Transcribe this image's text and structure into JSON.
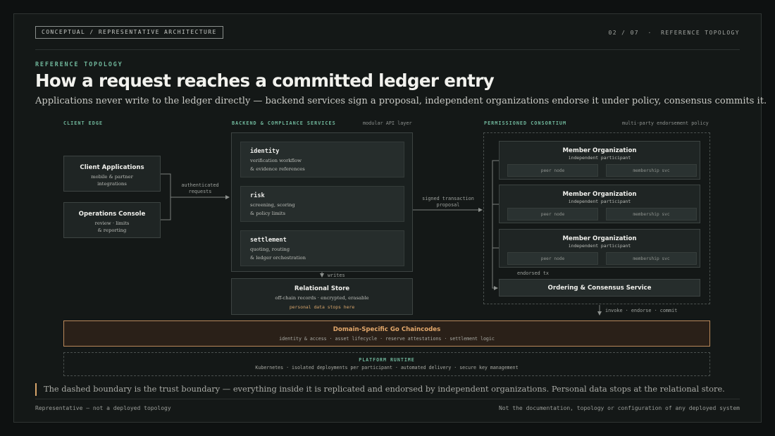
{
  "header": {
    "tag": "CONCEPTUAL / REPRESENTATIVE ARCHITECTURE",
    "page_indicator": "02 / 07  ·  REFERENCE TOPOLOGY"
  },
  "hero": {
    "eyebrow": "REFERENCE TOPOLOGY",
    "title": "How a request reaches a committed ledger entry",
    "subtitle": "Applications never write to the ledger directly — backend services sign a proposal, independent organizations endorse it under policy, consensus commits it."
  },
  "client_edge": {
    "heading": "CLIENT EDGE",
    "boxes": [
      {
        "title": "Client Applications",
        "sub1": "mobile & partner",
        "sub2": "integrations"
      },
      {
        "title": "Operations Console",
        "sub1": "review · limits",
        "sub2": "& reporting"
      }
    ],
    "edge_label_1": "authenticated",
    "edge_label_2": "requests"
  },
  "backend": {
    "heading": "BACKEND & COMPLIANCE SERVICES",
    "note": "modular API layer",
    "services": [
      {
        "title": "identity",
        "line1": "verification workflow",
        "line2": "& evidence references"
      },
      {
        "title": "risk",
        "line1": "screening, scoring",
        "line2": "& policy limits"
      },
      {
        "title": "settlement",
        "line1": "quoting, routing",
        "line2": "& ledger orchestration"
      }
    ],
    "writes_label": "writes",
    "edge_label_1": "signed transaction",
    "edge_label_2": "proposal"
  },
  "relational_store": {
    "title": "Relational Store",
    "sub": "off-chain records · encrypted, erasable",
    "note": "personal data stops here"
  },
  "consortium": {
    "heading": "PERMISSIONED CONSORTIUM",
    "note": "multi-party endorsement policy",
    "orgs": [
      {
        "title": "Member Organization",
        "sub": "independent participant",
        "pill1": "peer node",
        "pill2": "membership svc"
      },
      {
        "title": "Member Organization",
        "sub": "independent participant",
        "pill1": "peer node",
        "pill2": "membership svc"
      },
      {
        "title": "Member Organization",
        "sub": "independent participant",
        "pill1": "peer node",
        "pill2": "membership svc"
      }
    ],
    "endorsed_label": "endorsed tx",
    "ordering": "Ordering & Consensus Service",
    "invoke_label": "invoke · endorse · commit"
  },
  "chaincodes": {
    "title": "Domain-Specific Go Chaincodes",
    "sub": "identity & access · asset lifecycle · reserve attestations · settlement logic"
  },
  "runtime": {
    "heading": "PLATFORM RUNTIME",
    "sub": "Kubernetes · isolated deployments per participant · automated delivery · secure key management"
  },
  "callout": "The dashed boundary is the trust boundary — everything inside it is replicated and endorsed by independent organizations. Personal data stops at the relational store.",
  "footer": {
    "left": "Representative — not a deployed topology",
    "right": "Not the documentation, topology or configuration of any deployed system"
  },
  "colors": {
    "background": "#0e1111",
    "accent_green": "#6fb59a",
    "accent_amber": "#d7a46a",
    "chaincode_border": "#b9895a"
  }
}
